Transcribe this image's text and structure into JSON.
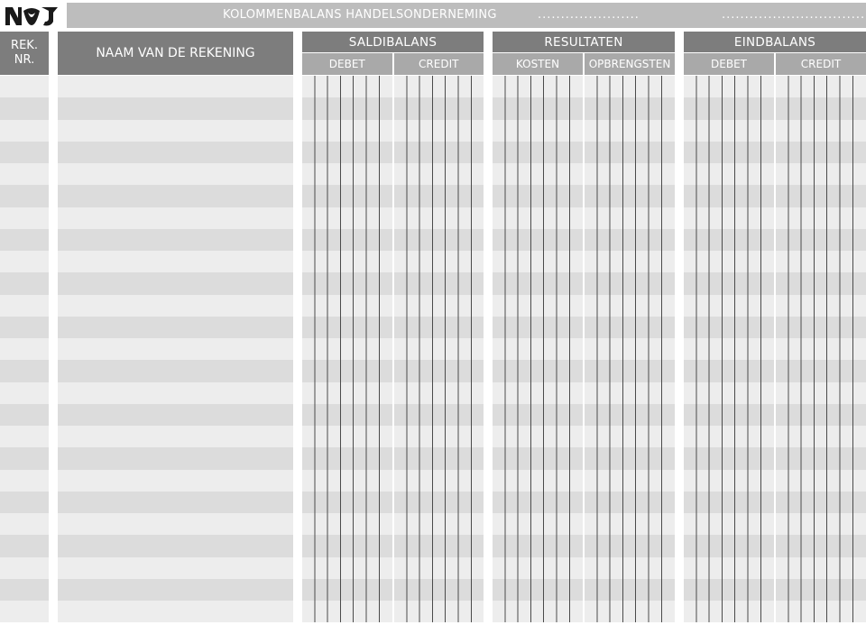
{
  "header": {
    "title": "KOLOMMENBALANS HANDELSONDERNEMING",
    "dots_left": "......................",
    "dots_right": "................................",
    "logo_text": "NOJ"
  },
  "columns": {
    "rek_line1": "REK.",
    "rek_line2": "NR.",
    "naam": "NAAM VAN DE REKENING",
    "groups": [
      {
        "title": "SALDIBALANS",
        "sub": [
          "DEBET",
          "CREDIT"
        ]
      },
      {
        "title": "RESULTATEN",
        "sub": [
          "KOSTEN",
          "OPBRENGSTEN"
        ]
      },
      {
        "title": "EINDBALANS",
        "sub": [
          "DEBET",
          "CREDIT"
        ]
      }
    ]
  },
  "colors": {
    "title_bar": "#bdbdbd",
    "header": "#7d7d7d",
    "subheader": "#a9a9a9",
    "row_light": "#ededed",
    "row_dark": "#dcdcdc"
  }
}
